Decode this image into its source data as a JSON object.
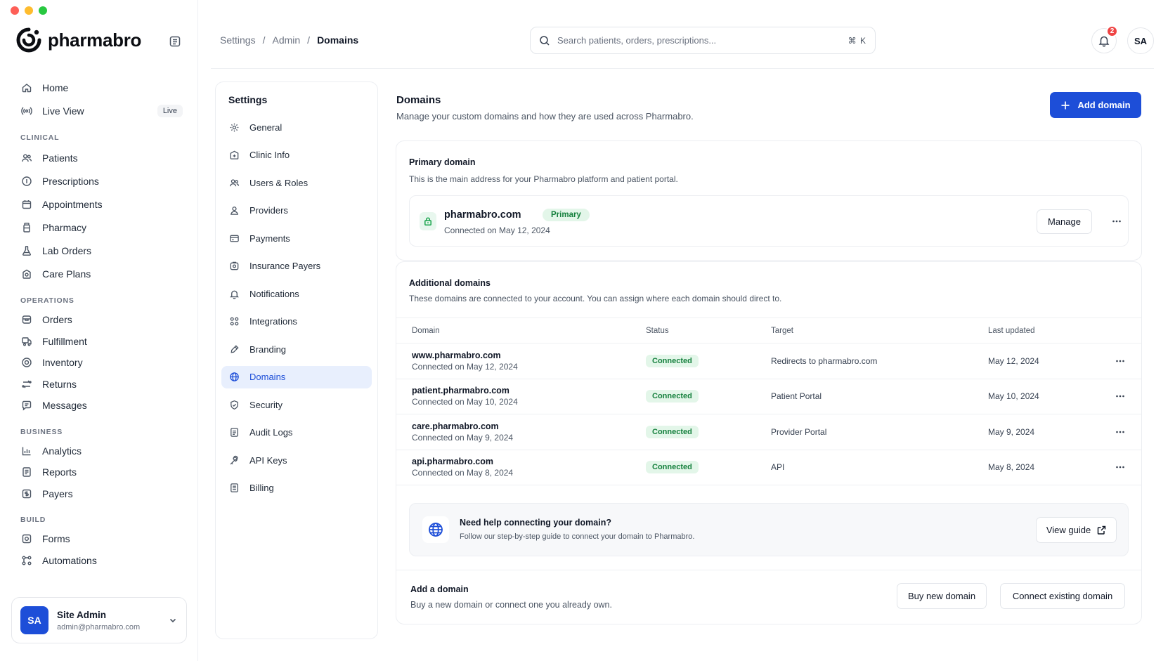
{
  "app": {
    "brand": "pharmabro"
  },
  "sidebar": {
    "top_items": [
      {
        "label": "Home",
        "icon": "home-icon"
      },
      {
        "label": "Live View",
        "icon": "broadcast-icon",
        "badge": "Live"
      }
    ],
    "sections": [
      {
        "title": "CLINICAL",
        "items": [
          {
            "label": "Patients",
            "icon": "users-icon"
          },
          {
            "label": "Prescriptions",
            "icon": "info-circle-icon"
          },
          {
            "label": "Appointments",
            "icon": "calendar-icon"
          },
          {
            "label": "Pharmacy",
            "icon": "bottle-icon"
          },
          {
            "label": "Lab Orders",
            "icon": "flask-icon"
          },
          {
            "label": "Care Plans",
            "icon": "care-icon"
          }
        ]
      },
      {
        "title": "OPERATIONS",
        "items": [
          {
            "label": "Orders",
            "icon": "box-icon"
          },
          {
            "label": "Fulfillment",
            "icon": "truck-icon"
          },
          {
            "label": "Inventory",
            "icon": "target-icon"
          },
          {
            "label": "Returns",
            "icon": "arrows-icon"
          },
          {
            "label": "Messages",
            "icon": "chat-icon"
          }
        ]
      },
      {
        "title": "BUSINESS",
        "items": [
          {
            "label": "Analytics",
            "icon": "bar-chart-icon"
          },
          {
            "label": "Reports",
            "icon": "report-icon"
          },
          {
            "label": "Payers",
            "icon": "payers-icon"
          }
        ]
      },
      {
        "title": "BUILD",
        "items": [
          {
            "label": "Forms",
            "icon": "form-icon"
          },
          {
            "label": "Automations",
            "icon": "automation-icon"
          }
        ]
      }
    ],
    "user": {
      "initials": "SA",
      "name": "Site Admin",
      "email": "admin@pharmabro.com"
    }
  },
  "header": {
    "breadcrumb": [
      "Settings",
      "Admin",
      "Domains"
    ],
    "search": {
      "placeholder": "Search patients, orders, prescriptions...",
      "shortcut": "⌘ K"
    },
    "notifications_count": "2",
    "avatar_initials": "SA"
  },
  "settings_nav": {
    "title": "Settings",
    "items": [
      {
        "label": "General",
        "icon": "gear-icon"
      },
      {
        "label": "Clinic Info",
        "icon": "clinic-icon"
      },
      {
        "label": "Users & Roles",
        "icon": "users-icon"
      },
      {
        "label": "Providers",
        "icon": "user-icon"
      },
      {
        "label": "Payments",
        "icon": "credit-card-icon"
      },
      {
        "label": "Insurance Payers",
        "icon": "insurance-icon"
      },
      {
        "label": "Notifications",
        "icon": "bell-icon"
      },
      {
        "label": "Integrations",
        "icon": "grid-icon"
      },
      {
        "label": "Branding",
        "icon": "brush-icon"
      },
      {
        "label": "Domains",
        "icon": "globe-icon",
        "active": true
      },
      {
        "label": "Security",
        "icon": "shield-icon"
      },
      {
        "label": "Audit Logs",
        "icon": "document-icon"
      },
      {
        "label": "API Keys",
        "icon": "key-icon"
      },
      {
        "label": "Billing",
        "icon": "billing-icon"
      }
    ]
  },
  "main": {
    "title": "Domains",
    "subtitle": "Manage your custom domains and how they are used across Pharmabro.",
    "add_button": "Add domain",
    "primary": {
      "heading": "Primary domain",
      "description": "This is the main address for your Pharmabro platform and patient portal.",
      "domain": "pharmabro.com",
      "badge": "Primary",
      "connected": "Connected on May 12, 2024",
      "manage_label": "Manage"
    },
    "additional": {
      "heading": "Additional domains",
      "description": "These domains are connected to your account. You can assign where each domain should direct to.",
      "columns": [
        "Domain",
        "Status",
        "Target",
        "Last updated"
      ],
      "rows": [
        {
          "domain": "www.pharmabro.com",
          "connected": "Connected on May 12, 2024",
          "status": "Connected",
          "target": "Redirects to pharmabro.com",
          "updated": "May 12, 2024"
        },
        {
          "domain": "patient.pharmabro.com",
          "connected": "Connected on May 10, 2024",
          "status": "Connected",
          "target": "Patient Portal",
          "updated": "May 10, 2024"
        },
        {
          "domain": "care.pharmabro.com",
          "connected": "Connected on May 9, 2024",
          "status": "Connected",
          "target": "Provider Portal",
          "updated": "May 9, 2024"
        },
        {
          "domain": "api.pharmabro.com",
          "connected": "Connected on May 8, 2024",
          "status": "Connected",
          "target": "API",
          "updated": "May 8, 2024"
        }
      ]
    },
    "help": {
      "heading": "Need help connecting your domain?",
      "description": "Follow our step-by-step guide to connect your domain to Pharmabro.",
      "button": "View guide"
    },
    "add_domain": {
      "heading": "Add a domain",
      "description": "Buy a new domain or connect one you already own.",
      "buy_button": "Buy new domain",
      "connect_button": "Connect existing domain"
    }
  },
  "colors": {
    "accent": "#1d4ed8",
    "success": "#15803d",
    "success_bg": "#e3f6e9",
    "badge_red": "#ef4444"
  }
}
